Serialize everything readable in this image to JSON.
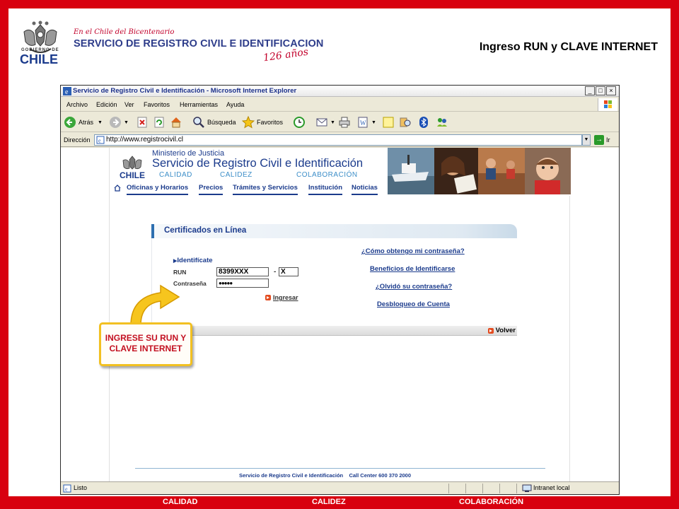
{
  "header": {
    "gov_label": "GOBIERNO DE",
    "gov_name": "CHILE",
    "bicentennial": "En el Chile del Bicentenario",
    "service_title": "SERVICIO DE REGISTRO CIVIL E IDENTIFICACION",
    "years": "126 años",
    "slide_title": "Ingreso RUN y CLAVE INTERNET"
  },
  "browser": {
    "window_title": "Servicio de Registro Civil e Identificación - Microsoft Internet Explorer",
    "menu": [
      "Archivo",
      "Edición",
      "Ver",
      "Favoritos",
      "Herramientas",
      "Ayuda"
    ],
    "toolbar": {
      "back": "Atrás",
      "search": "Búsqueda",
      "favorites": "Favoritos"
    },
    "address_label": "Dirección",
    "address_value": "http://www.registrocivil.cl",
    "go_label": "Ir",
    "status_text": "Listo",
    "status_zone": "Intranet local"
  },
  "site": {
    "ministry": "Ministerio de Justicia",
    "title": "Servicio de Registro Civil e Identificación",
    "logo_text": "CHILE",
    "slogans": [
      "CALIDAD",
      "CALIDEZ",
      "COLABORACIÓN"
    ],
    "nav": [
      "Oficinas y Horarios",
      "Precios",
      "Trámites y Servicios",
      "Institución",
      "Noticias"
    ],
    "panel_title": "Certificados en Línea",
    "identify_label": "Identifícate",
    "run_label": "RUN",
    "run_value": "8399XXX",
    "run_dash": "-",
    "run_dv": "X",
    "password_label": "Contraseña",
    "password_value": "●●●●●",
    "login_label": "Ingresar",
    "help_links": [
      "¿Cómo obtengo mi contraseña?",
      "Beneficios de Identificarse",
      "¿Olvidó su contraseña?",
      "Desbloqueo de Cuenta"
    ],
    "back_label": "Volver",
    "footer": "Servicio de Registro Civil e Identificación    Call Center 600 370 2000"
  },
  "callout": {
    "line1": "INGRESE SU RUN Y",
    "line2": "CLAVE INTERNET"
  },
  "footer": {
    "items": [
      "CALIDAD",
      "CALIDEZ",
      "COLABORACIÓN"
    ]
  },
  "colors": {
    "frame_red": "#d8000f",
    "brand_blue": "#1b3b8c",
    "callout_yellow": "#f2c020",
    "callout_text": "#c31020"
  }
}
